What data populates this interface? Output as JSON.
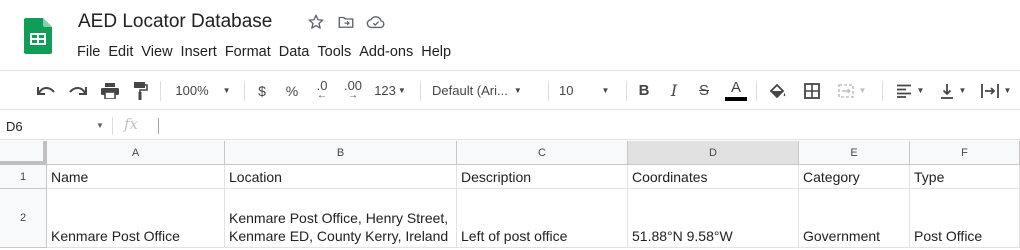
{
  "app": {
    "title": "AED Locator Database",
    "menu": [
      "File",
      "Edit",
      "View",
      "Insert",
      "Format",
      "Data",
      "Tools",
      "Add-ons",
      "Help"
    ]
  },
  "toolbar": {
    "zoom": "100%",
    "currency": "$",
    "percent": "%",
    "decrease_decimals": ".0",
    "increase_decimals": ".00",
    "more_formats": "123",
    "font": "Default (Ari...",
    "font_size": "10",
    "bold": "B",
    "italic": "I",
    "strikethrough": "S",
    "text_color": "A"
  },
  "formula_bar": {
    "cell_ref": "D6",
    "fx": "fx",
    "value": ""
  },
  "grid": {
    "columns": [
      "A",
      "B",
      "C",
      "D",
      "E",
      "F"
    ],
    "selected_column": "D",
    "rows": [
      {
        "number": "1",
        "cells": [
          "Name",
          "Location",
          "Description",
          "Coordinates",
          "Category",
          "Type"
        ]
      },
      {
        "number": "2",
        "cells": [
          "Kenmare Post Office",
          "Kenmare Post Office, Henry Street, Kenmare ED, County Kerry, Ireland",
          "Left of post office",
          "51.88°N 9.58°W",
          "Government",
          "Post Office"
        ]
      }
    ]
  },
  "colors": {
    "sheets_green": "#0f9d58",
    "header_bg": "#f8f9fa",
    "selected_header_bg": "#e1e1e1"
  }
}
